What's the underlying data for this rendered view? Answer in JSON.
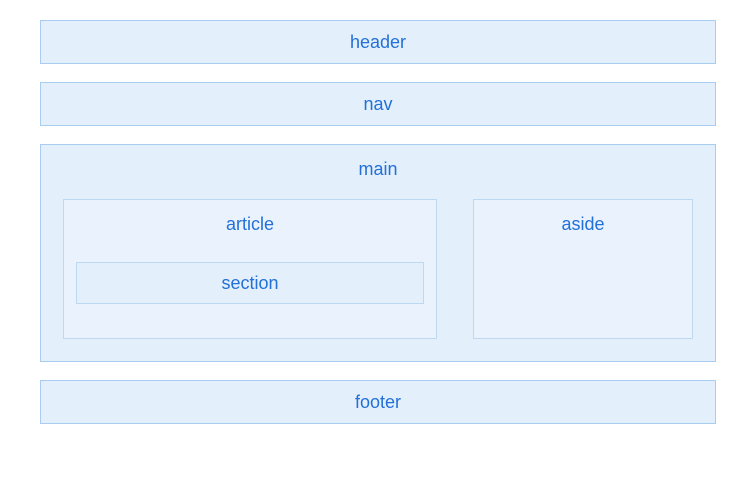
{
  "layout": {
    "header": "header",
    "nav": "nav",
    "main": "main",
    "article": "article",
    "section": "section",
    "aside": "aside",
    "footer": "footer"
  }
}
